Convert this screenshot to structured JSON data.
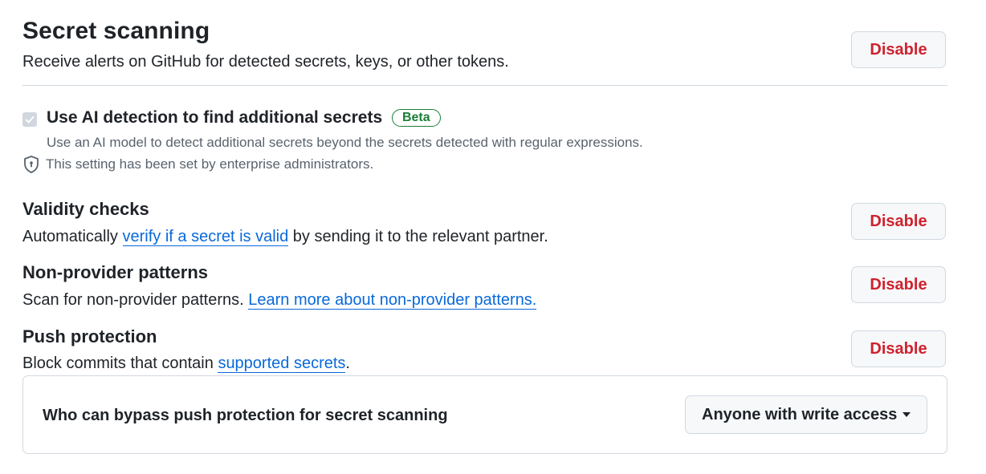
{
  "secret_scanning": {
    "title": "Secret scanning",
    "description": "Receive alerts on GitHub for detected secrets, keys, or other tokens.",
    "button": "Disable"
  },
  "ai_detection": {
    "label": "Use AI detection to find additional secrets",
    "badge": "Beta",
    "description": "Use an AI model to detect additional secrets beyond the secrets detected with regular expressions.",
    "note": "This setting has been set by enterprise administrators.",
    "checked": true,
    "disabled": true
  },
  "validity_checks": {
    "title": "Validity checks",
    "text_before": "Automatically ",
    "link": "verify if a secret is valid",
    "text_after": " by sending it to the relevant partner.",
    "button": "Disable"
  },
  "non_provider": {
    "title": "Non-provider patterns",
    "text_before": "Scan for non-provider patterns. ",
    "link": "Learn more about non-provider patterns.",
    "button": "Disable"
  },
  "push_protection": {
    "title": "Push protection",
    "text_before": "Block commits that contain ",
    "link": "supported secrets",
    "text_after": ".",
    "button": "Disable",
    "bypass_label": "Who can bypass push protection for secret scanning",
    "bypass_value": "Anyone with write access"
  },
  "colors": {
    "danger": "#cf222e",
    "link": "#0969da",
    "success": "#1a7f37"
  }
}
